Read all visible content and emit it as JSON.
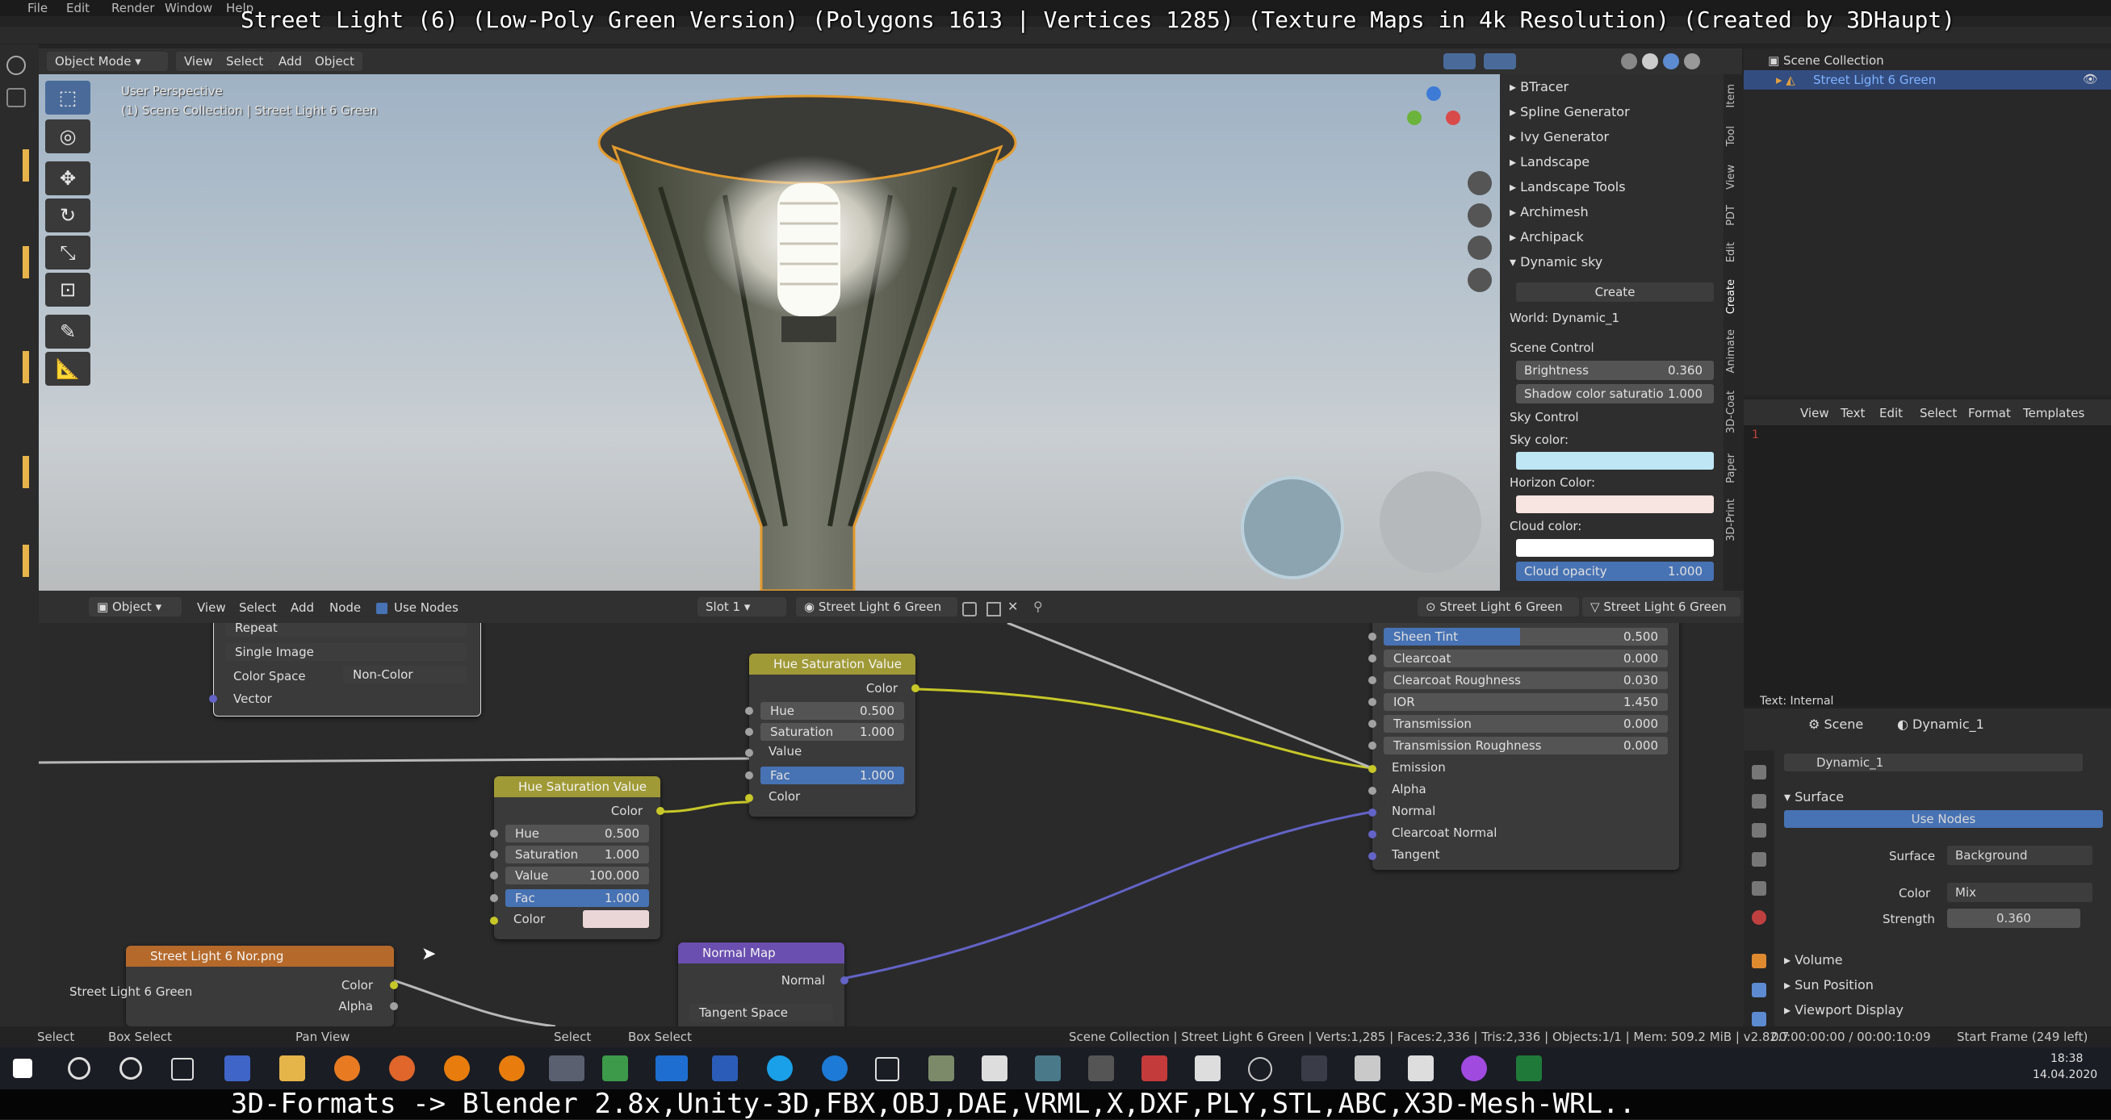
{
  "overlay": {
    "title": "Street Light (6) (Low-Poly Green Version) (Polygons 1613 | Vertices 1285) (Texture Maps in 4k Resolution) (Created by 3DHaupt)",
    "bottom_text": "3D-Formats -> Blender 2.8x,Unity-3D,FBX,OBJ,DAE,VRML,X,DXF,PLY,STL,ABC,X3D-Mesh-WRL.."
  },
  "topmenu": [
    "File",
    "Edit",
    "Render",
    "Window",
    "Help"
  ],
  "viewport": {
    "mode": "Object Mode",
    "menus": [
      "View",
      "Select",
      "Add",
      "Object"
    ],
    "perspective": "User Perspective",
    "collection_info": "(1) Scene Collection | Street Light 6 Green"
  },
  "npanel": {
    "items": [
      "BTracer",
      "Spline Generator",
      "Ivy Generator",
      "Landscape",
      "Landscape Tools",
      "Archimesh",
      "Archipack",
      "Dynamic sky"
    ],
    "create_button": "Create",
    "world": "World: Dynamic_1",
    "scene_control": "Scene Control",
    "brightness_label": "Brightness",
    "brightness_value": "0.360",
    "shadow_label": "Shadow color saturatio",
    "shadow_value": "1.000",
    "sky_control": "Sky Control",
    "sky_color_label": "Sky color:",
    "sky_color": "#bfe6f4",
    "horizon_label": "Horizon Color:",
    "horizon_color": "#f8e4e0",
    "cloud_color_label": "Cloud color:",
    "cloud_color": "#ffffff",
    "cloud_opacity_label": "Cloud opacity",
    "cloud_opacity_value": "1.000",
    "tabs": [
      "Item",
      "Tool",
      "View",
      "PDT",
      "Edit",
      "Create",
      "Animate",
      "3D-Coat",
      "Paper",
      "3D-Print"
    ]
  },
  "outliner": {
    "root": "Scene Collection",
    "item": "Street Light 6 Green"
  },
  "text_editor": {
    "menus": [
      "View",
      "Text",
      "Edit",
      "Select",
      "Format",
      "Templates"
    ],
    "line_number": "1",
    "footer": "Text: Internal"
  },
  "properties": {
    "scene_tab": "Scene",
    "world_tab": "Dynamic_1",
    "world_name": "Dynamic_1",
    "surface_section": "Surface",
    "use_nodes": "Use Nodes",
    "surface_label": "Surface",
    "surface_value": "Background",
    "color_label": "Color",
    "color_value": "Mix",
    "strength_label": "Strength",
    "strength_value": "0.360",
    "sections": [
      "Volume",
      "Sun Position",
      "Viewport Display"
    ]
  },
  "node_header": {
    "editor_type": "Object",
    "menus": [
      "View",
      "Select",
      "Add",
      "Node"
    ],
    "use_nodes": "Use Nodes",
    "slot": "Slot 1",
    "material": "Street Light 6 Green",
    "object": "Street Light 6 Green",
    "object2": "Street Light 6 Green"
  },
  "nodes": {
    "image_node": {
      "repeat": "Repeat",
      "single_image": "Single Image",
      "color_space_label": "Color Space",
      "color_space_value": "Non-Color",
      "vector": "Vector"
    },
    "hsv1": {
      "title": "Hue Saturation Value",
      "color_out": "Color",
      "hue_label": "Hue",
      "hue": "0.500",
      "sat_label": "Saturation",
      "sat": "1.000",
      "value_label": "Value",
      "fac_label": "Fac",
      "fac": "1.000",
      "color_in": "Color"
    },
    "hsv2": {
      "title": "Hue Saturation Value",
      "color_out": "Color",
      "hue_label": "Hue",
      "hue": "0.500",
      "sat_label": "Saturation",
      "sat": "1.000",
      "value_label": "Value",
      "value": "100.000",
      "fac_label": "Fac",
      "fac": "1.000",
      "color_in": "Color",
      "color_swatch": "#ead6d6"
    },
    "bsdf": {
      "rows": [
        {
          "label": "Sheen Tint",
          "value": "0.500"
        },
        {
          "label": "Clearcoat",
          "value": "0.000"
        },
        {
          "label": "Clearcoat Roughness",
          "value": "0.030"
        },
        {
          "label": "IOR",
          "value": "1.450"
        },
        {
          "label": "Transmission",
          "value": "0.000"
        },
        {
          "label": "Transmission Roughness",
          "value": "0.000"
        }
      ],
      "sockets": [
        "Emission",
        "Alpha",
        "Normal",
        "Clearcoat Normal",
        "Tangent"
      ]
    },
    "texture_node": {
      "title": "Street Light 6 Nor.png",
      "color": "Color",
      "alpha": "Alpha",
      "image_label": "Street Light 6 Green"
    },
    "normal_map": {
      "title": "Normal Map",
      "normal": "Normal",
      "space": "Tangent Space"
    }
  },
  "statusbar": {
    "select": "Select",
    "box_select": "Box Select",
    "pan_view": "Pan View",
    "select2": "Select",
    "box_select2": "Box Select",
    "stats": "Scene Collection | Street Light 6 Green | Verts:1,285 | Faces:2,336 | Tris:2,336 | Objects:1/1 | Mem: 509.2 MiB | v2.82.7",
    "time": "00:00:00:00 / 00:00:10:09",
    "start_frame": "Start Frame (249 left)"
  },
  "taskbar": {
    "clock_time": "18:38",
    "clock_date": "14.04.2020"
  }
}
